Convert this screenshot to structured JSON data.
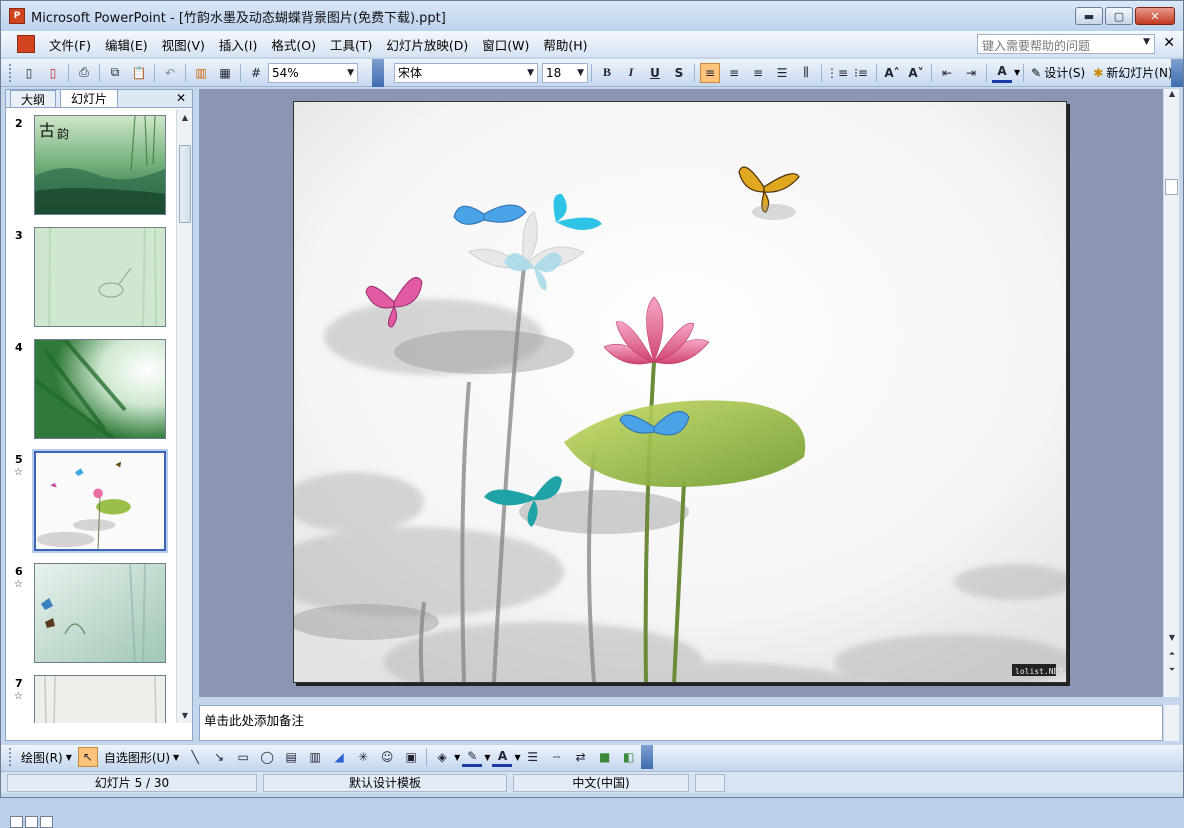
{
  "window": {
    "title": "Microsoft PowerPoint - [竹韵水墨及动态蝴蝶背景图片(免费下载).ppt]",
    "buttons": [
      "minimize",
      "maximize",
      "close"
    ]
  },
  "menubar": {
    "items": [
      "文件(F)",
      "编辑(E)",
      "视图(V)",
      "插入(I)",
      "格式(O)",
      "工具(T)",
      "幻灯片放映(D)",
      "窗口(W)",
      "帮助(H)"
    ],
    "help_placeholder": "键入需要帮助的问题"
  },
  "toolbar": {
    "zoom": "54%",
    "font_name": "宋体",
    "font_size": "18",
    "design_label": "设计(S)",
    "new_slide_label": "新幻灯片(N)"
  },
  "side_panel": {
    "tabs": [
      "大纲",
      "幻灯片"
    ],
    "active_tab": "幻灯片",
    "slides": [
      {
        "num": "2",
        "star": ""
      },
      {
        "num": "3",
        "star": ""
      },
      {
        "num": "4",
        "star": ""
      },
      {
        "num": "5",
        "star": "☆",
        "selected": true
      },
      {
        "num": "6",
        "star": "☆"
      },
      {
        "num": "7",
        "star": "☆"
      }
    ]
  },
  "slide": {
    "watermark": "lolist.NET"
  },
  "notes": {
    "placeholder": "单击此处添加备注"
  },
  "drawbar": {
    "draw_label": "绘图(R)",
    "autoshapes_label": "自选图形(U)"
  },
  "status": {
    "slide_pos": "幻灯片 5 / 30",
    "template": "默认设计模板",
    "language": "中文(中国)"
  },
  "colors": {
    "titlebar": "#bcd2ee",
    "slide_bg": "#8a96b3",
    "selection": "#3a63b5"
  }
}
